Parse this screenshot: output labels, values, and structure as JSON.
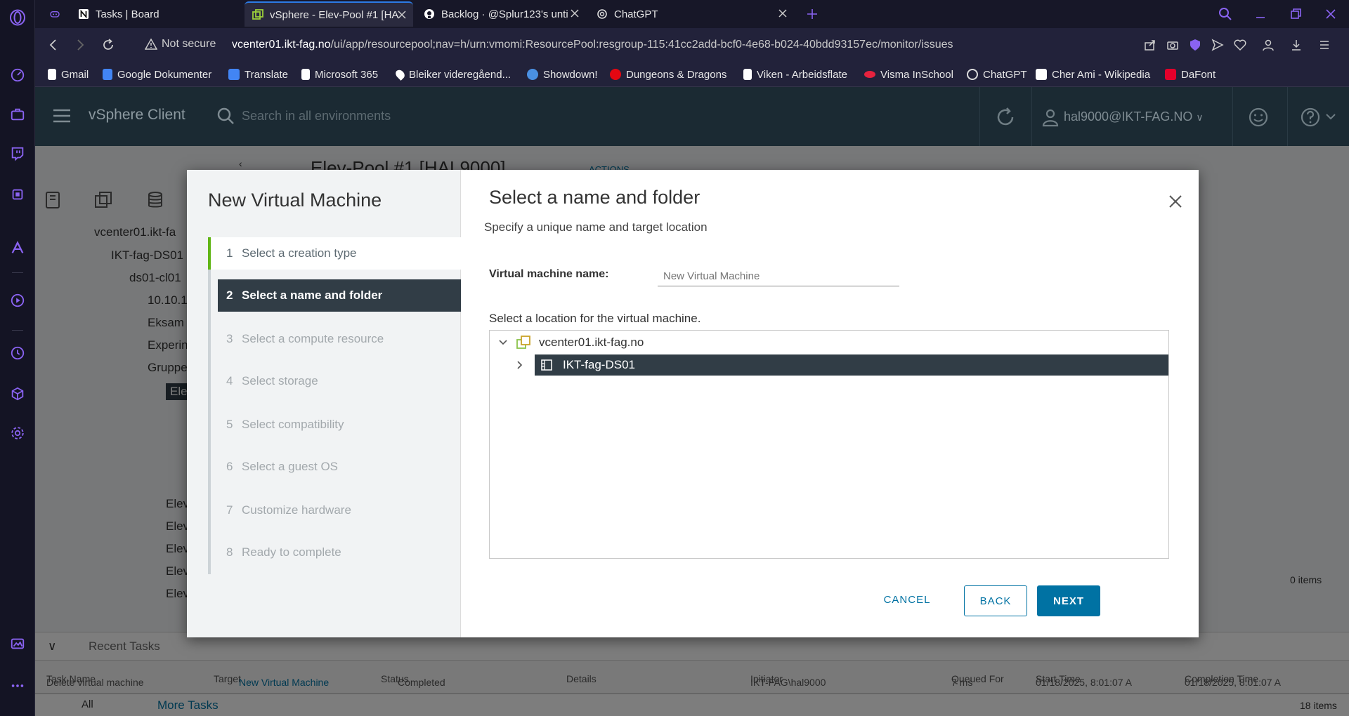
{
  "tabs": [
    {
      "title": "Tasks | Board",
      "icon": "notion-icon"
    },
    {
      "title": "vSphere - Elev-Pool #1 [HA",
      "icon": "vsphere-icon",
      "active": true
    },
    {
      "title": "Backlog · @Splur123's unti",
      "icon": "github-icon"
    },
    {
      "title": "ChatGPT",
      "icon": "chatgpt-icon"
    }
  ],
  "address": {
    "security": "Not secure",
    "host": "vcenter01.ikt-fag.no",
    "path": "/ui/app/resourcepool;nav=h/urn:vmomi:ResourcePool:resgroup-115:41cc2add-bcf0-4e68-b024-40bdd93157ec/monitor/issues"
  },
  "bookmarks": [
    {
      "label": "Gmail",
      "color": "#ffffff"
    },
    {
      "label": "Google Dokumenter",
      "color": "#4285f4"
    },
    {
      "label": "Translate",
      "color": "#4285f4"
    },
    {
      "label": "Microsoft 365",
      "color": "#ffffff"
    },
    {
      "label": "Bleiker videregåend...",
      "color": "#ffffff"
    },
    {
      "label": "Showdown!",
      "color": "#4a90e2"
    },
    {
      "label": "Dungeons & Dragons",
      "color": "#e40712"
    },
    {
      "label": "Viken - Arbeidsflate",
      "color": "#ffffff"
    },
    {
      "label": "Visma InSchool",
      "color": "#e6223e"
    },
    {
      "label": "ChatGPT",
      "color": "#ffffff"
    },
    {
      "label": "Cher Ami - Wikipedia",
      "color": "#ffffff"
    },
    {
      "label": "DaFont",
      "color": "#e4002b"
    }
  ],
  "vsphere": {
    "app_title": "vSphere Client",
    "search_placeholder": "Search in all environments",
    "user": "hal9000@IKT-FAG.NO"
  },
  "background": {
    "tree": [
      "vcenter01.ikt-fa",
      "IKT-fag-DS01",
      "ds01-cl01",
      "10.10.1.",
      "Eksam",
      "Experin",
      "Gruppe",
      "Elev",
      "Elev",
      "Elev",
      "Elev",
      "Elev",
      "Elev"
    ],
    "pool_title": "Elev-Pool #1 [HAL9000]",
    "actions": "ACTIONS",
    "items_count": "0 items",
    "recent_tasks": "Recent Tasks",
    "task_columns": [
      "Task Name",
      "Target",
      "Status",
      "Details",
      "Initiator",
      "Queued For",
      "Start Time",
      "Completion Time"
    ],
    "task_row": [
      "Delete virtual machine",
      "New Virtual Machine",
      "Completed",
      "",
      "IKT-FAG\\hal9000",
      "7 ms",
      "01/18/2025, 8:01:07 A",
      "01/18/2025, 8:01:07 A"
    ],
    "filter_all": "All",
    "more_tasks": "More Tasks",
    "task_count": "18 items"
  },
  "wizard": {
    "title": "New Virtual Machine",
    "steps": [
      {
        "num": "1",
        "label": "Select a creation type",
        "state": "done"
      },
      {
        "num": "2",
        "label": "Select a name and folder",
        "state": "current"
      },
      {
        "num": "3",
        "label": "Select a compute resource",
        "state": "pending"
      },
      {
        "num": "4",
        "label": "Select storage",
        "state": "pending"
      },
      {
        "num": "5",
        "label": "Select compatibility",
        "state": "pending"
      },
      {
        "num": "6",
        "label": "Select a guest OS",
        "state": "pending"
      },
      {
        "num": "7",
        "label": "Customize hardware",
        "state": "pending"
      },
      {
        "num": "8",
        "label": "Ready to complete",
        "state": "pending"
      }
    ],
    "page_title": "Select a name and folder",
    "page_subtitle": "Specify a unique name and target location",
    "vm_name_label": "Virtual machine name:",
    "vm_name_placeholder": "New Virtual Machine",
    "vm_name_value": "",
    "location_label": "Select a location for the virtual machine.",
    "tree": [
      {
        "label": "vcenter01.ikt-fag.no",
        "expanded": true,
        "selected": false
      },
      {
        "label": "IKT-fag-DS01",
        "expanded": false,
        "selected": true
      }
    ],
    "cancel_label": "CANCEL",
    "back_label": "BACK",
    "next_label": "NEXT"
  },
  "colors": {
    "accent": "#0072a3",
    "selected": "#313d46",
    "done_step": "#60b515",
    "opera": "#8a63f2"
  }
}
